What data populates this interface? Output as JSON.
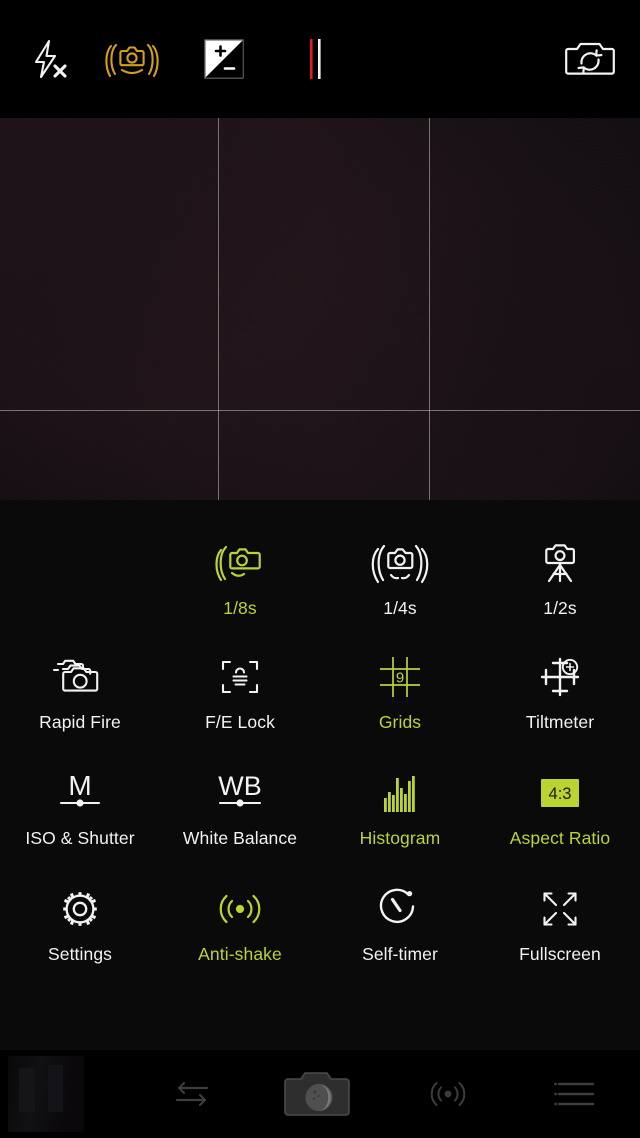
{
  "colors": {
    "accent": "#bcd432",
    "accent_amber": "#d4a017",
    "icon_default": "#f2f2f2",
    "background": "#000000",
    "panel": "#0a0a0a",
    "viewfinder": "#0d0a0c",
    "grid_line": "#b0b0aa",
    "level_red": "#e01b1b",
    "bottom_icon": "#3a3a3a"
  },
  "topbar": {
    "items": [
      {
        "name": "flash-off",
        "label": "Flash Off",
        "icon": "flash-off-icon",
        "active": false
      },
      {
        "name": "stabilization",
        "label": "Stabilization",
        "icon": "anti-shake-camera-icon",
        "active": true
      },
      {
        "name": "exposure-compensation",
        "label": "Exposure Compensation",
        "icon": "exposure-compensation-icon",
        "active": false
      },
      {
        "name": "level-indicator",
        "label": "Level",
        "icon": "level-bars-icon",
        "active": false
      },
      {
        "name": "switch-camera",
        "label": "Switch Camera",
        "icon": "camera-switch-icon",
        "active": false
      }
    ]
  },
  "viewfinder": {
    "grid_enabled": true,
    "grid_columns": 3,
    "grid_rows": 3,
    "aspect_ratio": "4:3"
  },
  "menu": {
    "shutter_row": [
      {
        "label": "1/8s",
        "icon": "handheld-camera-icon",
        "active": true
      },
      {
        "label": "1/4s",
        "icon": "two-hand-camera-icon",
        "active": false
      },
      {
        "label": "1/2s",
        "icon": "tripod-camera-icon",
        "active": false
      }
    ],
    "row2": [
      {
        "label": "Rapid Fire",
        "icon": "stacked-cameras-icon",
        "active": false
      },
      {
        "label": "F/E Lock",
        "icon": "focus-exposure-lock-icon",
        "active": false
      },
      {
        "label": "Grids",
        "icon": "grid-nine-icon",
        "active": true,
        "badge": "9"
      },
      {
        "label": "Tiltmeter",
        "icon": "crosshair-level-icon",
        "active": false
      }
    ],
    "row3": [
      {
        "label": "ISO & Shutter",
        "icon": "manual-slider-icon",
        "active": false,
        "badge": "M"
      },
      {
        "label": "White Balance",
        "icon": "white-balance-slider-icon",
        "active": false,
        "badge": "WB"
      },
      {
        "label": "Histogram",
        "icon": "histogram-icon",
        "active": true
      },
      {
        "label": "Aspect Ratio",
        "icon": "aspect-ratio-icon",
        "active": true,
        "badge": "4:3"
      }
    ],
    "row4": [
      {
        "label": "Settings",
        "icon": "gear-icon",
        "active": false
      },
      {
        "label": "Anti-shake",
        "icon": "vibration-waves-icon",
        "active": true
      },
      {
        "label": "Self-timer",
        "icon": "stopwatch-icon",
        "active": false
      },
      {
        "label": "Fullscreen",
        "icon": "expand-arrows-icon",
        "active": false
      }
    ]
  },
  "bottombar": {
    "items": [
      {
        "name": "gallery-thumbnail",
        "label": "Gallery",
        "icon": "photo-thumbnail"
      },
      {
        "name": "swap-mode",
        "label": "Swap",
        "icon": "swap-arrows-icon"
      },
      {
        "name": "shutter",
        "label": "Shutter",
        "icon": "camera-shutter-icon"
      },
      {
        "name": "anti-shake-toggle",
        "label": "Anti-shake",
        "icon": "vibration-waves-icon"
      },
      {
        "name": "menu",
        "label": "Menu",
        "icon": "list-menu-icon"
      }
    ]
  }
}
